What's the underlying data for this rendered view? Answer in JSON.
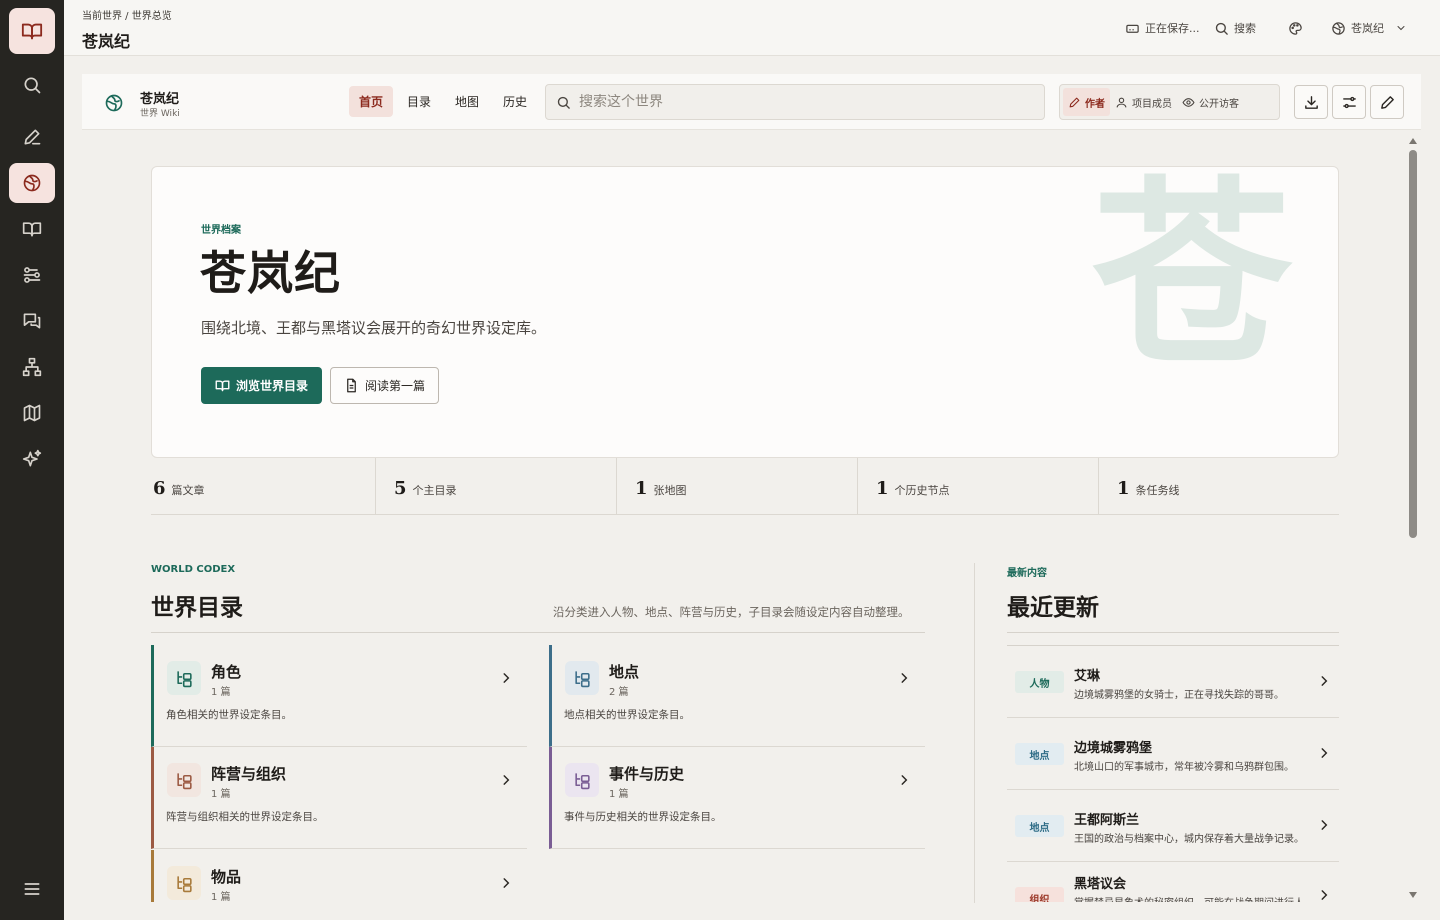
{
  "header": {
    "breadcrumb": "当前世界 / 世界总览",
    "title": "苍岚纪",
    "saving": "正在保存...",
    "search": "搜索",
    "world_switch": "苍岚纪"
  },
  "toolbar": {
    "world_name": "苍岚纪",
    "world_sub": "世界 Wiki",
    "tabs": [
      "首页",
      "目录",
      "地图",
      "历史"
    ],
    "search_placeholder": "搜索这个世界",
    "roles": [
      "作者",
      "项目成员",
      "公开访客"
    ]
  },
  "hero": {
    "eyebrow": "世界档案",
    "title": "苍岚纪",
    "description": "围绕北境、王都与黑塔议会展开的奇幻世界设定库。",
    "primary_button": "浏览世界目录",
    "secondary_button": "阅读第一篇",
    "watermark": "苍"
  },
  "stats": [
    {
      "num": "6",
      "label": "篇文章"
    },
    {
      "num": "5",
      "label": "个主目录"
    },
    {
      "num": "1",
      "label": "张地图"
    },
    {
      "num": "1",
      "label": "个历史节点"
    },
    {
      "num": "1",
      "label": "条任务线"
    }
  ],
  "codex": {
    "eyebrow": "WORLD CODEX",
    "title": "世界目录",
    "note": "沿分类进入人物、地点、阵营与历史，子目录会随设定内容自动整理。",
    "cards": [
      {
        "title": "角色",
        "count": "1 篇",
        "desc": "角色相关的世界设定条目。",
        "color": "#1d6a5a",
        "bg": "#e2ece7"
      },
      {
        "title": "地点",
        "count": "2 篇",
        "desc": "地点相关的世界设定条目。",
        "color": "#3d6e8a",
        "bg": "#e2e9ee"
      },
      {
        "title": "阵营与组织",
        "count": "1 篇",
        "desc": "阵营与组织相关的世界设定条目。",
        "color": "#9c5a43",
        "bg": "#f2e6e0"
      },
      {
        "title": "事件与历史",
        "count": "1 篇",
        "desc": "事件与历史相关的世界设定条目。",
        "color": "#7a5d94",
        "bg": "#ebe5f0"
      },
      {
        "title": "物品",
        "count": "1 篇",
        "desc": "",
        "color": "#a87a3a",
        "bg": "#f3eadb"
      }
    ]
  },
  "recent": {
    "eyebrow": "最新内容",
    "title": "最近更新",
    "items": [
      {
        "tag": "人物",
        "title": "艾琳",
        "desc": "边境城雾鸦堡的女骑士，正在寻找失踪的哥哥。",
        "tag_color": "#1d6a5a",
        "tag_bg": "#e2ece7"
      },
      {
        "tag": "地点",
        "title": "边境城雾鸦堡",
        "desc": "北境山口的军事城市，常年被冷雾和乌鸦群包围。",
        "tag_color": "#2e6c86",
        "tag_bg": "#e2ecf1"
      },
      {
        "tag": "地点",
        "title": "王都阿斯兰",
        "desc": "王国的政治与档案中心，城内保存着大量战争记录。",
        "tag_color": "#2e6c86",
        "tag_bg": "#e2ecf1"
      },
      {
        "tag": "组织",
        "title": "黑塔议会",
        "desc": "掌握禁忌星象术的秘密组织，可能在战争期间进行人体实验。",
        "tag_color": "#9c3a2a",
        "tag_bg": "#f6e1dc"
      }
    ]
  }
}
